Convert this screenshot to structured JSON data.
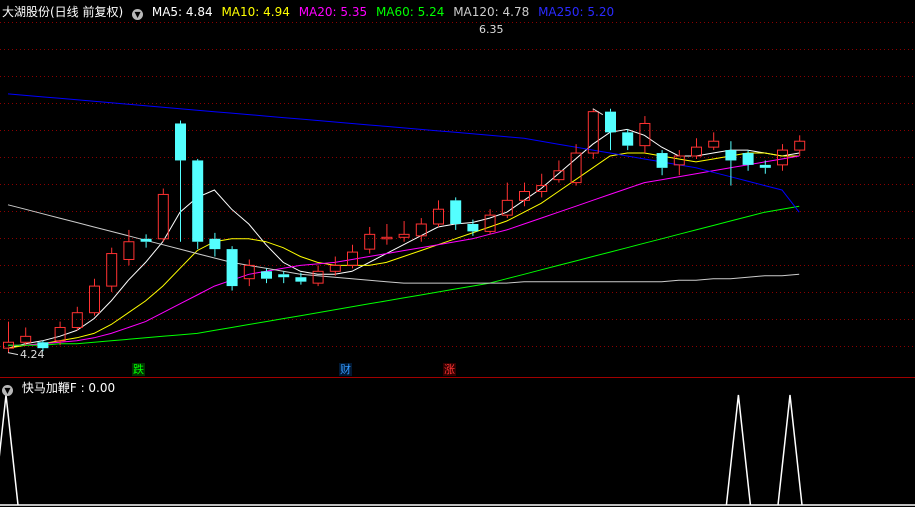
{
  "header": {
    "title": "大湖股份(日线 前复权)",
    "ma": [
      {
        "label": "MA5: 4.84",
        "color": "#ffffff"
      },
      {
        "label": "MA10: 4.94",
        "color": "#ffff00"
      },
      {
        "label": "MA20: 5.35",
        "color": "#ff00ff"
      },
      {
        "label": "MA60: 5.24",
        "color": "#00ff00"
      },
      {
        "label": "MA120: 4.78",
        "color": "#cccccc"
      },
      {
        "label": "MA250: 5.20",
        "color": "#0000ff"
      }
    ]
  },
  "indicator": {
    "title": "快马加鞭F",
    "value": ": 0.00"
  },
  "annotations": {
    "high_label": "6.35",
    "low_label": "4.24",
    "events": [
      {
        "text": "跌",
        "color": "#00ff00",
        "bg": "#003300",
        "index": 16
      },
      {
        "text": "财",
        "color": "#3399ff",
        "bg": "#001833",
        "index": 42
      },
      {
        "text": "涨",
        "color": "#ff3333",
        "bg": "#330000",
        "index": 55
      }
    ]
  },
  "colors": {
    "up": "#ff3232",
    "down": "#54ffff",
    "grid": "#8b0000",
    "background": "#000000"
  },
  "chart_data": {
    "type": "candlestick",
    "ylim": [
      4.2,
      6.5
    ],
    "candles": [
      [
        4.28,
        4.32,
        4.46,
        4.25
      ],
      [
        4.32,
        4.36,
        4.42,
        4.3
      ],
      [
        4.32,
        4.28,
        4.33,
        4.26
      ],
      [
        4.33,
        4.42,
        4.46,
        4.3
      ],
      [
        4.42,
        4.52,
        4.56,
        4.4
      ],
      [
        4.52,
        4.7,
        4.75,
        4.5
      ],
      [
        4.7,
        4.92,
        4.96,
        4.66
      ],
      [
        4.88,
        5.0,
        5.08,
        4.84
      ],
      [
        5.02,
        5.0,
        5.05,
        4.96
      ],
      [
        5.02,
        5.32,
        5.36,
        5.0
      ],
      [
        5.8,
        5.55,
        5.82,
        5.0
      ],
      [
        5.55,
        5.0,
        5.56,
        4.95
      ],
      [
        5.02,
        4.95,
        5.06,
        4.9
      ],
      [
        4.95,
        4.7,
        4.97,
        4.67
      ],
      [
        4.75,
        4.84,
        4.88,
        4.7
      ],
      [
        4.8,
        4.75,
        4.82,
        4.72
      ],
      [
        4.78,
        4.76,
        4.8,
        4.72
      ],
      [
        4.76,
        4.73,
        4.79,
        4.71
      ],
      [
        4.72,
        4.8,
        4.84,
        4.7
      ],
      [
        4.8,
        4.84,
        4.9,
        4.77
      ],
      [
        4.84,
        4.93,
        4.98,
        4.82
      ],
      [
        4.95,
        5.05,
        5.1,
        4.92
      ],
      [
        5.02,
        5.03,
        5.12,
        4.98
      ],
      [
        5.03,
        5.05,
        5.14,
        5.0
      ],
      [
        5.04,
        5.12,
        5.16,
        5.0
      ],
      [
        5.12,
        5.22,
        5.28,
        5.1
      ],
      [
        5.28,
        5.12,
        5.3,
        5.08
      ],
      [
        5.12,
        5.07,
        5.15,
        5.04
      ],
      [
        5.07,
        5.18,
        5.22,
        5.05
      ],
      [
        5.18,
        5.28,
        5.4,
        5.16
      ],
      [
        5.28,
        5.34,
        5.4,
        5.24
      ],
      [
        5.34,
        5.38,
        5.46,
        5.3
      ],
      [
        5.42,
        5.48,
        5.55,
        5.4
      ],
      [
        5.4,
        5.6,
        5.66,
        5.38
      ],
      [
        5.6,
        5.88,
        5.9,
        5.56
      ],
      [
        5.88,
        5.74,
        5.9,
        5.62
      ],
      [
        5.74,
        5.65,
        5.76,
        5.62
      ],
      [
        5.65,
        5.8,
        5.85,
        5.6
      ],
      [
        5.6,
        5.5,
        5.62,
        5.45
      ],
      [
        5.52,
        5.58,
        5.62,
        5.45
      ],
      [
        5.58,
        5.64,
        5.7,
        5.56
      ],
      [
        5.64,
        5.68,
        5.74,
        5.62
      ],
      [
        5.62,
        5.55,
        5.68,
        5.38
      ],
      [
        5.6,
        5.52,
        5.62,
        5.48
      ],
      [
        5.52,
        5.5,
        5.55,
        5.46
      ],
      [
        5.52,
        5.62,
        5.66,
        5.48
      ],
      [
        5.62,
        5.68,
        5.72,
        5.58
      ]
    ],
    "ma": {
      "MA5": [
        4.28,
        4.31,
        4.33,
        4.36,
        4.4,
        4.48,
        4.6,
        4.74,
        4.86,
        5.0,
        5.2,
        5.3,
        5.35,
        5.22,
        5.12,
        4.98,
        4.86,
        4.8,
        4.78,
        4.78,
        4.8,
        4.86,
        4.92,
        4.98,
        5.04,
        5.1,
        5.12,
        5.13,
        5.16,
        5.2,
        5.28,
        5.36,
        5.46,
        5.56,
        5.66,
        5.74,
        5.76,
        5.72,
        5.64,
        5.58,
        5.58,
        5.6,
        5.62,
        5.62,
        5.6,
        5.58,
        5.6
      ],
      "MA10": [
        4.28,
        4.3,
        4.31,
        4.33,
        4.35,
        4.38,
        4.44,
        4.52,
        4.6,
        4.7,
        4.82,
        4.94,
        5.0,
        5.02,
        5.02,
        5.0,
        4.96,
        4.9,
        4.86,
        4.84,
        4.84,
        4.84,
        4.86,
        4.9,
        4.94,
        4.98,
        5.02,
        5.06,
        5.1,
        5.14,
        5.2,
        5.26,
        5.34,
        5.42,
        5.5,
        5.58,
        5.6,
        5.6,
        5.58,
        5.56,
        5.54,
        5.56,
        5.58,
        5.6,
        5.6,
        5.58,
        5.58
      ],
      "MA20": [
        4.3,
        4.3,
        4.31,
        4.32,
        4.33,
        4.35,
        4.38,
        4.42,
        4.46,
        4.52,
        4.58,
        4.64,
        4.7,
        4.74,
        4.78,
        4.8,
        4.82,
        4.84,
        4.85,
        4.86,
        4.88,
        4.9,
        4.92,
        4.94,
        4.96,
        4.98,
        5.0,
        5.02,
        5.05,
        5.08,
        5.12,
        5.16,
        5.2,
        5.24,
        5.28,
        5.32,
        5.36,
        5.4,
        5.42,
        5.44,
        5.46,
        5.48,
        5.5,
        5.52,
        5.54,
        5.56,
        5.58
      ],
      "MA60": [
        4.3,
        4.3,
        4.3,
        4.31,
        4.31,
        4.32,
        4.33,
        4.34,
        4.35,
        4.36,
        4.37,
        4.38,
        4.4,
        4.42,
        4.44,
        4.46,
        4.48,
        4.5,
        4.52,
        4.54,
        4.56,
        4.58,
        4.6,
        4.62,
        4.64,
        4.66,
        4.68,
        4.7,
        4.72,
        4.75,
        4.78,
        4.81,
        4.84,
        4.87,
        4.9,
        4.93,
        4.96,
        4.99,
        5.02,
        5.05,
        5.08,
        5.11,
        5.14,
        5.17,
        5.2,
        5.22,
        5.24
      ],
      "MA120": [
        5.25,
        5.22,
        5.19,
        5.16,
        5.13,
        5.1,
        5.07,
        5.04,
        5.01,
        4.98,
        4.95,
        4.92,
        4.89,
        4.86,
        4.84,
        4.82,
        4.8,
        4.78,
        4.77,
        4.76,
        4.75,
        4.74,
        4.73,
        4.72,
        4.72,
        4.72,
        4.72,
        4.72,
        4.72,
        4.72,
        4.73,
        4.73,
        4.73,
        4.73,
        4.73,
        4.73,
        4.73,
        4.73,
        4.73,
        4.74,
        4.74,
        4.75,
        4.75,
        4.76,
        4.77,
        4.77,
        4.78
      ],
      "MA250": [
        6.0,
        5.99,
        5.98,
        5.97,
        5.96,
        5.95,
        5.94,
        5.93,
        5.92,
        5.91,
        5.9,
        5.89,
        5.88,
        5.87,
        5.86,
        5.85,
        5.84,
        5.83,
        5.82,
        5.81,
        5.8,
        5.79,
        5.78,
        5.77,
        5.76,
        5.75,
        5.74,
        5.73,
        5.72,
        5.71,
        5.7,
        5.68,
        5.66,
        5.64,
        5.62,
        5.6,
        5.58,
        5.56,
        5.54,
        5.52,
        5.5,
        5.47,
        5.44,
        5.41,
        5.38,
        5.35,
        5.2
      ]
    },
    "indicator": {
      "name": "快马加鞭F",
      "values": [
        1,
        0,
        0,
        0,
        0,
        0,
        0,
        0,
        0,
        0,
        0,
        0,
        0,
        0,
        0,
        0,
        0,
        0,
        0,
        0,
        0,
        0,
        0,
        0,
        0,
        0,
        0,
        0,
        0,
        0,
        0,
        0,
        0,
        0,
        0,
        0,
        0,
        0,
        0,
        0,
        0,
        0,
        1,
        0,
        0,
        1,
        0
      ]
    }
  }
}
